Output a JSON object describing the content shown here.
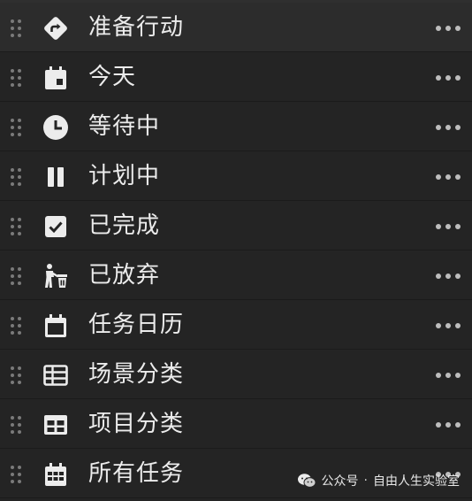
{
  "items": [
    {
      "label": "准备行动",
      "icon": "next-action-icon",
      "active": true
    },
    {
      "label": "今天",
      "icon": "today-calendar-icon",
      "active": false
    },
    {
      "label": "等待中",
      "icon": "clock-icon",
      "active": false
    },
    {
      "label": "计划中",
      "icon": "pause-icon",
      "active": false
    },
    {
      "label": "已完成",
      "icon": "checkbox-checked-icon",
      "active": false
    },
    {
      "label": "已放弃",
      "icon": "discard-trash-icon",
      "active": false
    },
    {
      "label": "任务日历",
      "icon": "calendar-icon",
      "active": false
    },
    {
      "label": "场景分类",
      "icon": "table-grid-icon",
      "active": false
    },
    {
      "label": "项目分类",
      "icon": "project-grid-icon",
      "active": false
    },
    {
      "label": "所有任务",
      "icon": "calendar-grid-icon",
      "active": false
    }
  ],
  "watermark": {
    "account": "公众号",
    "separator": "·",
    "name": "自由人生实验室"
  }
}
